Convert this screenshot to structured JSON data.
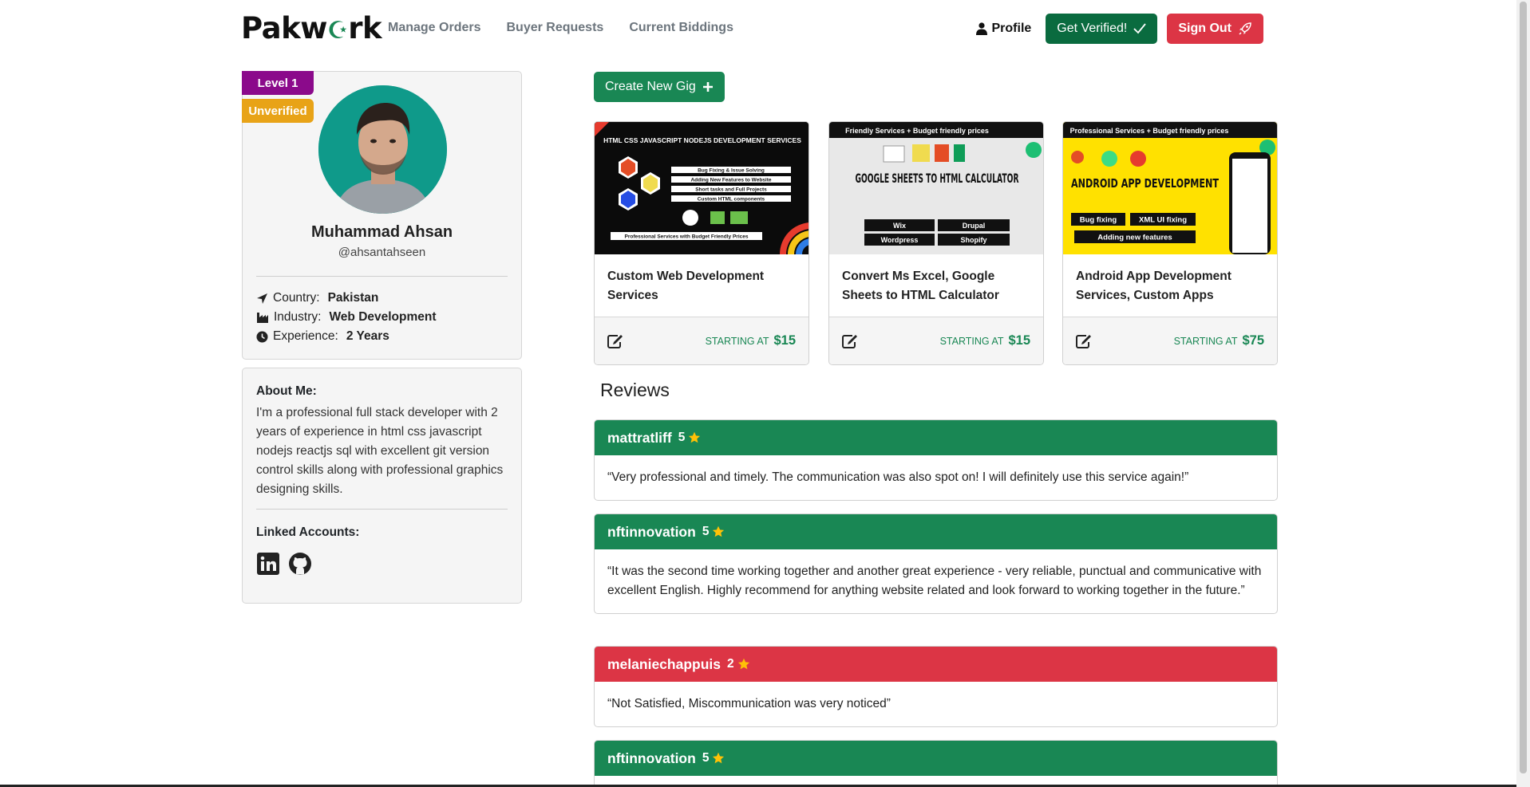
{
  "navbar": {
    "brand": "Pakwork",
    "brand_parts": [
      "Pakw",
      "rk"
    ],
    "links": [
      {
        "label": "Manage Orders"
      },
      {
        "label": "Buyer Requests"
      },
      {
        "label": "Current Biddings"
      }
    ],
    "profile_label": "Profile",
    "verify_label": "Get Verified!",
    "signout_label": "Sign Out"
  },
  "profile": {
    "level": "Level 1",
    "status": "Unverified",
    "name": "Muhammad Ahsan",
    "handle": "@ahsantahseen",
    "country_label": "Country:",
    "country": "Pakistan",
    "industry_label": "Industry:",
    "industry": "Web Development",
    "experience_label": "Experience:",
    "experience": "2 Years"
  },
  "about": {
    "title": "About Me:",
    "text": "I'm a professional full stack developer with 2 years of experience in html css javascript nodejs reactjs sql with excellent git version control skills along with professional graphics designing skills.",
    "linked_title": "Linked Accounts:",
    "accounts": [
      "linkedin-icon",
      "github-icon"
    ]
  },
  "gigs": {
    "create_label": "Create New Gig",
    "items": [
      {
        "title": "Custom Web Development Services",
        "starting_label": "STARTING AT",
        "price": "$15",
        "image": {
          "banner": "HTML CSS JAVASCRIPT NODEJS DEVELOPMENT SERVICES",
          "lines": [
            "Bug Fixing & Issue Solving",
            "Adding New Features to Website",
            "Short tasks and Full Projects",
            "Custom HTML components"
          ],
          "footer": "Professional Services with Budget Friendly Prices"
        }
      },
      {
        "title": "Convert Ms Excel, Google Sheets to HTML Calculator",
        "starting_label": "STARTING AT",
        "price": "$15",
        "image": {
          "banner": "Friendly Services + Budget friendly prices",
          "headline": "GOOGLE SHEETS TO HTML CALCULATOR",
          "tags": [
            "Wix",
            "Drupal",
            "Wordpress",
            "Shopify"
          ]
        }
      },
      {
        "title": "Android App Development Services, Custom Apps",
        "starting_label": "STARTING AT",
        "price": "$75",
        "image": {
          "banner": "Professional Services + Budget friendly prices",
          "headline": "ANDROID APP DEVELOPMENT",
          "tags": [
            "Bug fixing",
            "XML UI fixing",
            "Adding new features"
          ]
        }
      }
    ]
  },
  "reviews": {
    "title": "Reviews",
    "items": [
      {
        "user": "mattratliff",
        "rating": "5",
        "color": "#198754",
        "text": "“Very professional and timely. The communication was also spot on! I will definitely use this service again!”"
      },
      {
        "user": "nftinnovation",
        "rating": "5",
        "color": "#198754",
        "text": "“It was the second time working together and another great experience - very reliable, punctual and communicative with excellent English. Highly recommend for anything website related and look forward to working together in the future.”"
      },
      {
        "user": "melaniechappuis",
        "rating": "2",
        "color": "#dc3545",
        "text": "“Not Satisfied, Miscommunication was very noticed”"
      },
      {
        "user": "nftinnovation",
        "rating": "5",
        "color": "#198754",
        "text": ""
      }
    ]
  },
  "colors": {
    "primary_green": "#198754",
    "danger_red": "#dc3545",
    "level_purple": "#8b0a8b",
    "unverified_amber": "#e8a317",
    "star_yellow": "#ffc107"
  }
}
